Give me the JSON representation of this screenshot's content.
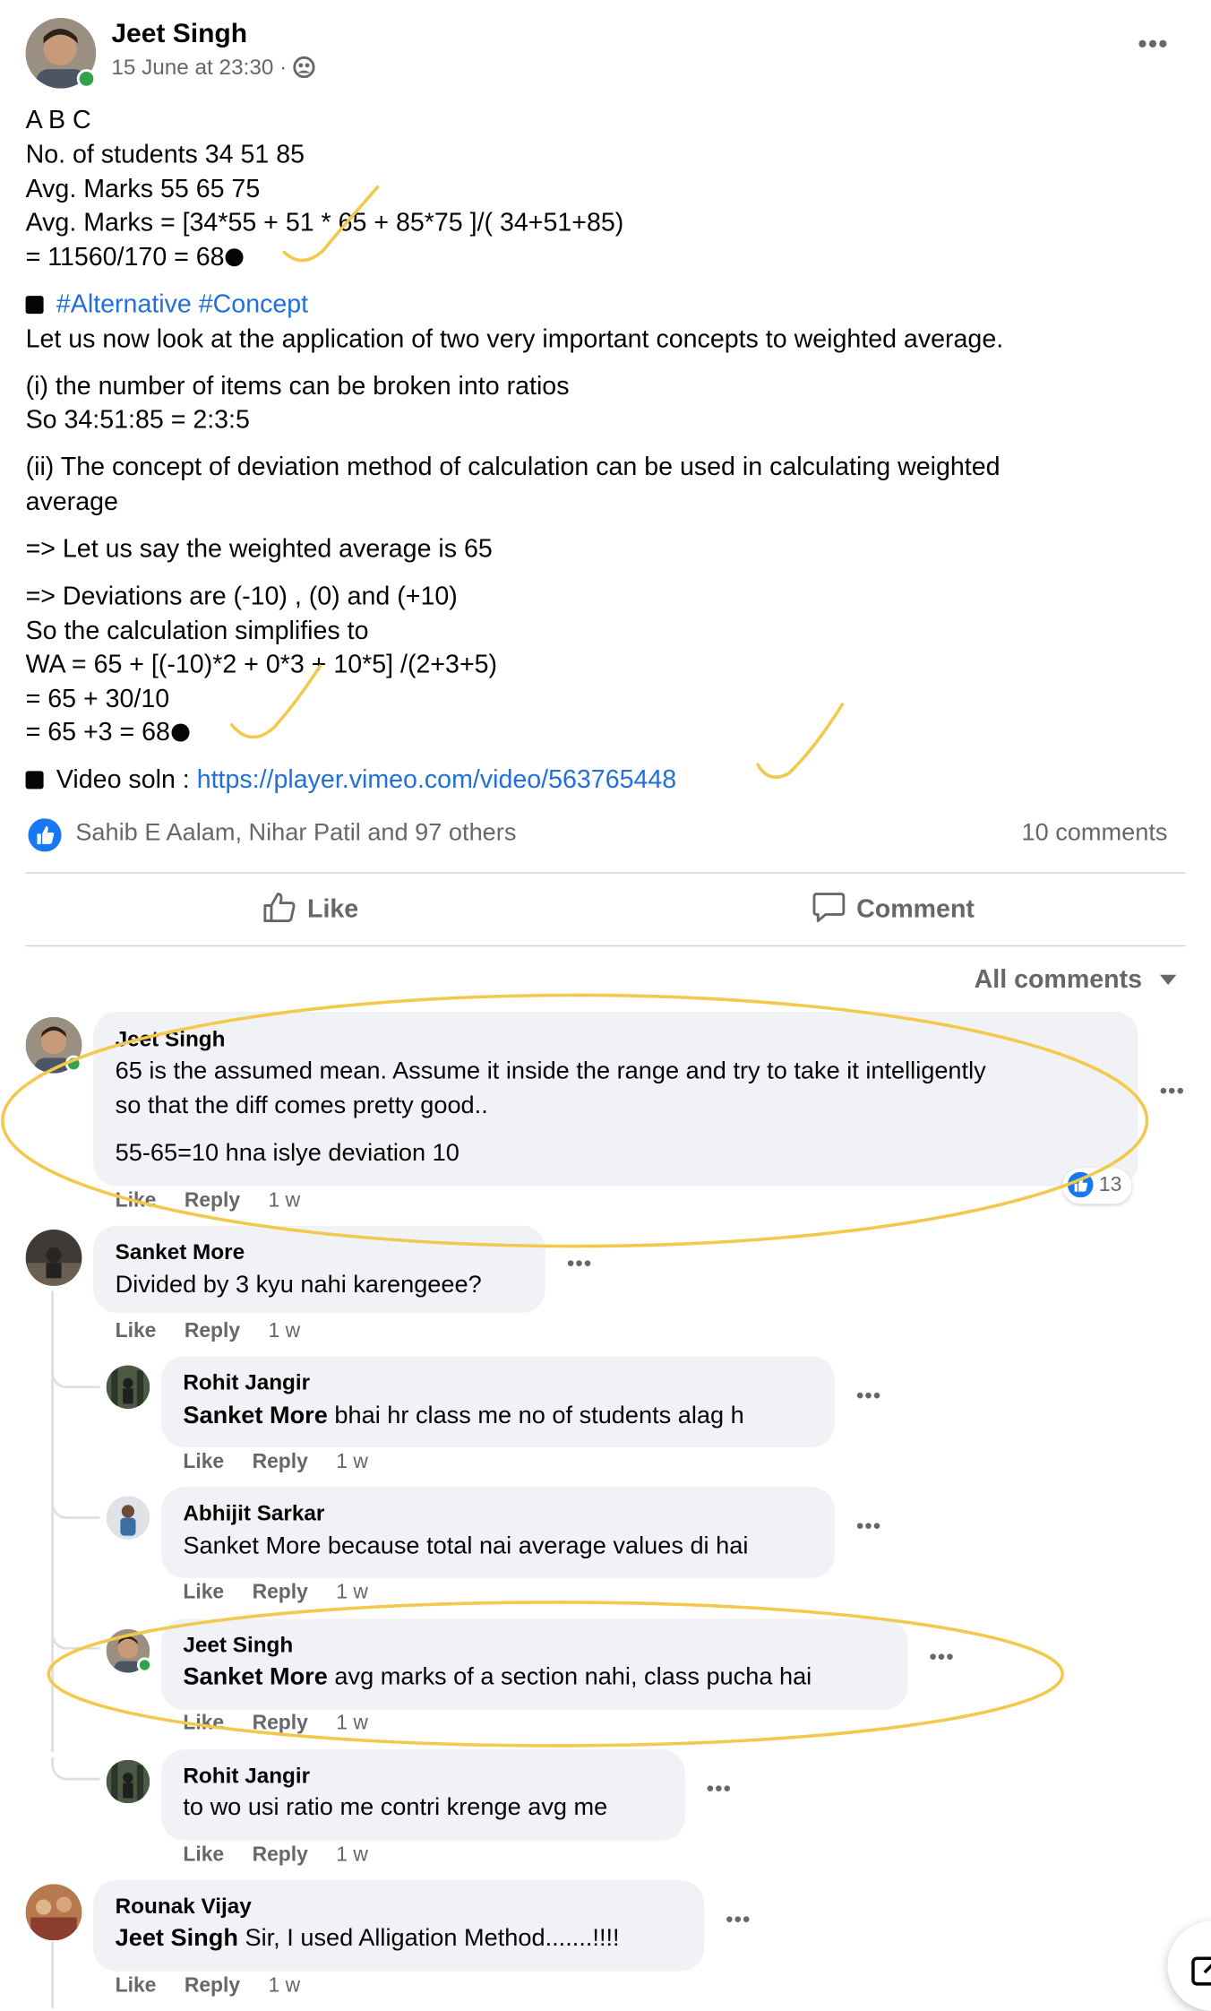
{
  "post": {
    "author": "Jeet Singh",
    "timestamp": "15 June at 23:30 ·",
    "lines": [
      "A B C",
      "No. of students 34 51 85",
      "Avg. Marks 55 65 75",
      "Avg. Marks = [34*55 + 51 * 65 + 85*75 ]/( 34+51+85)",
      "= 11560/170 = 68",
      "#Alternative #Concept",
      "Let us now look at the application of two very important concepts to weighted average.",
      "(i) the number of items can be broken into ratios",
      "So 34:51:85 = 2:3:5",
      "(ii) The concept of deviation method of calculation can be used in calculating weighted",
      "average",
      "=> Let us say the weighted average is 65",
      "=> Deviations are (-10) , (0) and (+10)",
      "So the calculation simplifies to",
      "WA = 65 + [(-10)*2 + 0*3 + 10*5] /(2+3+5)",
      "= 65 + 30/10",
      "= 65 +3 = 68",
      "Video soln :",
      "https://player.vimeo.com/video/563765448"
    ],
    "reactions_text": "Sahib E Aalam, Nihar Patil and 97 others",
    "comments_count": "10 comments"
  },
  "actions": {
    "like": "Like",
    "comment": "Comment"
  },
  "filter": "All comments",
  "comments": [
    {
      "name": "Jeet Singh",
      "text1": "65 is the assumed mean. Assume it inside the range and try to take it intelligently",
      "text2": "so that the diff comes pretty good..",
      "text3": "55-65=10 hna islye deviation 10",
      "reactions": "13",
      "like": "Like",
      "reply": "Reply",
      "time": "1 w"
    },
    {
      "name": "Sanket More",
      "text": "Divided by 3 kyu nahi karengeee?",
      "like": "Like",
      "reply": "Reply",
      "time": "1 w"
    },
    {
      "name": "Rohit Jangir",
      "mention": "Sanket More",
      "text": " bhai hr class me no of students alag h",
      "like": "Like",
      "reply": "Reply",
      "time": "1 w"
    },
    {
      "name": "Abhijit Sarkar",
      "text": "Sanket More because total nai average values di hai",
      "like": "Like",
      "reply": "Reply",
      "time": "1 w"
    },
    {
      "name": "Jeet Singh",
      "mention": "Sanket More",
      "text": " avg marks of a section nahi, class pucha hai",
      "like": "Like",
      "reply": "Reply",
      "time": "1 w"
    },
    {
      "name": "Rohit Jangir",
      "text": "to wo usi ratio me contri krenge avg me",
      "like": "Like",
      "reply": "Reply",
      "time": "1 w"
    },
    {
      "name": "Rounak Vijay",
      "mention": "Jeet Singh",
      "text": " Sir, I used Alligation Method.......!!!!",
      "like": "Like",
      "reply": "Reply",
      "time": "1 w"
    }
  ],
  "colors": {
    "link": "#216fdb",
    "annotation": "#f2c94c",
    "like_blue": "#1877f2"
  }
}
